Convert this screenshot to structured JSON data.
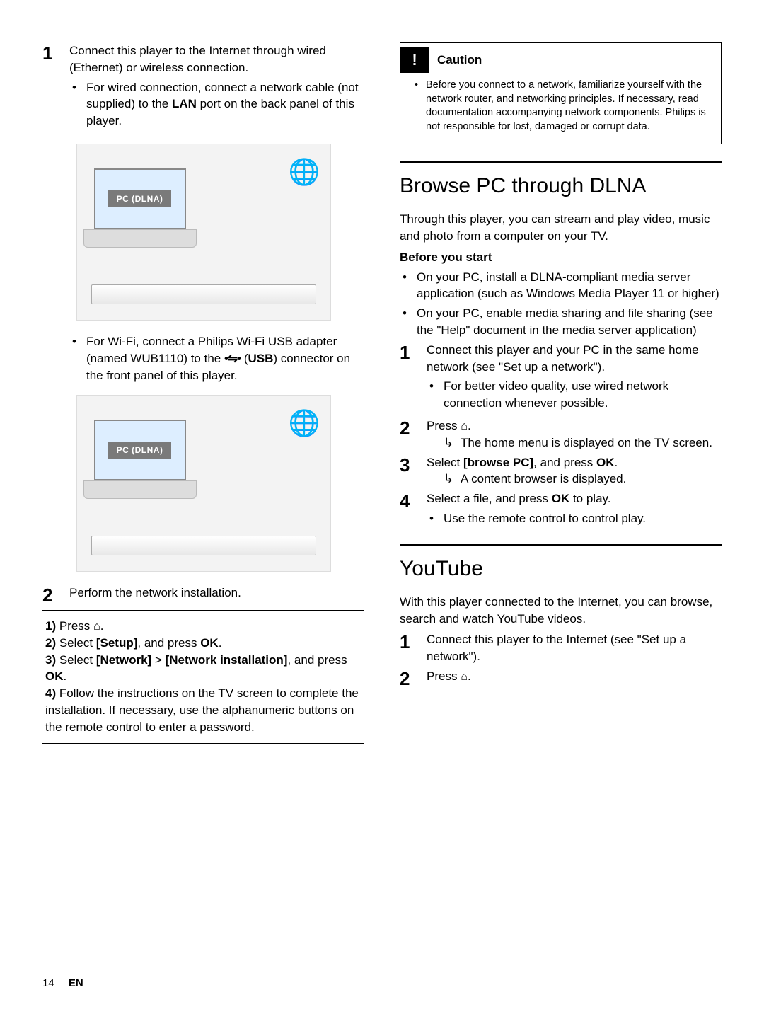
{
  "left": {
    "step1": {
      "num": "1",
      "text": "Connect this player to the Internet through wired (Ethernet) or wireless connection.",
      "bullet_wired_a": "For wired connection, connect a network cable (not supplied) to the ",
      "bullet_wired_b": "LAN",
      "bullet_wired_c": " port on the back panel of this player."
    },
    "diagram_pc_label": "PC (DLNA)",
    "bullet_wifi_a": "For Wi-Fi, connect a Philips Wi-Fi USB adapter (named WUB1110) to the ",
    "bullet_wifi_b_usb_sym": "•⇋•",
    "bullet_wifi_c": " (",
    "bullet_wifi_d": "USB",
    "bullet_wifi_e": ") connector on the front panel of this player.",
    "step2": {
      "num": "2",
      "text": "Perform the network installation."
    },
    "sub1_n": "1)",
    "sub1_a": " Press ",
    "home_glyph": "⌂",
    "period": ".",
    "sub2_n": "2)",
    "sub2_a": " Select ",
    "sub2_b": "[Setup]",
    "sub2_c": ", and press ",
    "sub2_d": "OK",
    "sub3_n": "3)",
    "sub3_a": " Select ",
    "sub3_b": "[Network]",
    "sub3_c": " > ",
    "sub3_d": "[Network installation]",
    "sub3_e": ", and press ",
    "sub3_f": "OK",
    "sub4_n": "4)",
    "sub4_a": " Follow the instructions on the TV screen to complete the installation. If necessary, use the alphanumeric buttons on the remote control to enter a password."
  },
  "right": {
    "caution_title": "Caution",
    "caution_text": "Before you connect to a network, familiarize yourself with the network router, and networking principles. If necessary, read documentation accompanying network components. Philips is not responsible for lost, damaged or corrupt data.",
    "dlna_heading": "Browse PC through DLNA",
    "dlna_intro": "Through this player, you can stream and play video, music and photo from a computer on your TV.",
    "before_label": "Before you start",
    "before_b1": "On your PC, install a DLNA-compliant media server application (such as Windows Media Player 11 or higher)",
    "before_b2": "On your PC, enable media sharing and file sharing (see the \"Help\" document in the media server application)",
    "d_step1": {
      "num": "1",
      "text": "Connect this player and your PC in the same home network (see \"Set up a network\").",
      "sub_bullet": "For better video quality, use wired network connection whenever possible."
    },
    "d_step2": {
      "num": "2",
      "a": "Press ",
      "arrow_glyph": "↳",
      "res": " The home menu is displayed on the TV screen."
    },
    "d_step3": {
      "num": "3",
      "a": "Select ",
      "b": "[browse PC]",
      "c": ", and press ",
      "d": "OK",
      "res": " A content browser is displayed."
    },
    "d_step4": {
      "num": "4",
      "a": "Select a file, and press ",
      "b": "OK",
      "c": " to play.",
      "sub_bullet": "Use the remote control to control play."
    },
    "yt_heading": "YouTube",
    "yt_intro": "With this player connected to the Internet, you can browse, search and watch YouTube videos.",
    "yt_step1": {
      "num": "1",
      "text": "Connect this player to the Internet (see \"Set up a network\")."
    },
    "yt_step2": {
      "num": "2",
      "a": "Press "
    }
  },
  "footer": {
    "page": "14",
    "lang": "EN"
  }
}
